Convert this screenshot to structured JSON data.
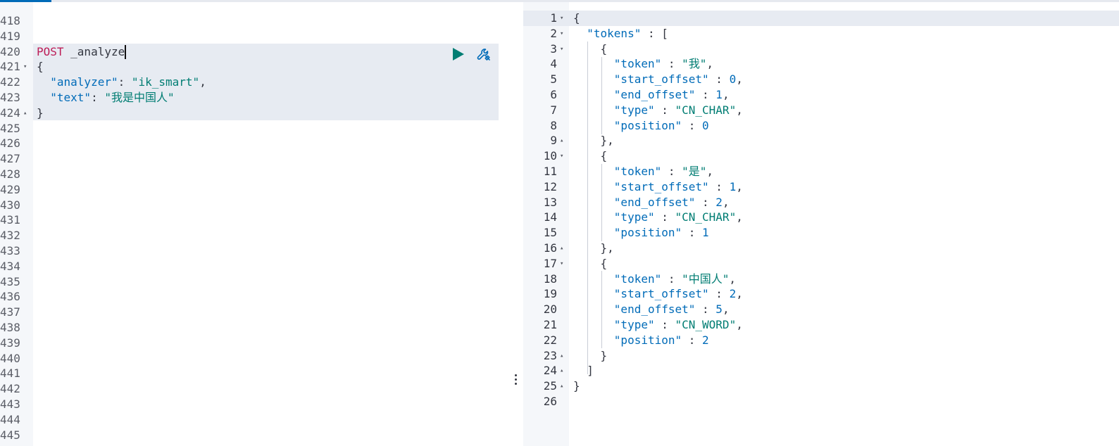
{
  "left_editor": {
    "lines": [
      {
        "num": "418",
        "fold": "",
        "segments": []
      },
      {
        "num": "419",
        "fold": "",
        "segments": []
      },
      {
        "num": "420",
        "fold": "",
        "segments": [
          {
            "text": "POST",
            "cls": "tok-method"
          },
          {
            "text": " _analyze",
            "cls": "tok-path"
          }
        ],
        "cursor": true
      },
      {
        "num": "421",
        "fold": "▾",
        "segments": [
          {
            "text": "{",
            "cls": "tok-punct"
          }
        ]
      },
      {
        "num": "422",
        "fold": "",
        "segments": [
          {
            "text": "  ",
            "cls": "tok-punct"
          },
          {
            "text": "\"analyzer\"",
            "cls": "tok-key"
          },
          {
            "text": ": ",
            "cls": "tok-punct"
          },
          {
            "text": "\"ik_smart\"",
            "cls": "tok-str"
          },
          {
            "text": ",",
            "cls": "tok-punct"
          }
        ]
      },
      {
        "num": "423",
        "fold": "",
        "segments": [
          {
            "text": "  ",
            "cls": "tok-punct"
          },
          {
            "text": "\"text\"",
            "cls": "tok-key"
          },
          {
            "text": ": ",
            "cls": "tok-punct"
          },
          {
            "text": "\"我是中国人\"",
            "cls": "tok-str"
          }
        ]
      },
      {
        "num": "424",
        "fold": "▴",
        "segments": [
          {
            "text": "}",
            "cls": "tok-punct"
          }
        ]
      },
      {
        "num": "425",
        "fold": "",
        "segments": []
      },
      {
        "num": "426",
        "fold": "",
        "segments": []
      },
      {
        "num": "427",
        "fold": "",
        "segments": []
      },
      {
        "num": "428",
        "fold": "",
        "segments": []
      },
      {
        "num": "429",
        "fold": "",
        "segments": []
      },
      {
        "num": "430",
        "fold": "",
        "segments": []
      },
      {
        "num": "431",
        "fold": "",
        "segments": []
      },
      {
        "num": "432",
        "fold": "",
        "segments": []
      },
      {
        "num": "433",
        "fold": "",
        "segments": []
      },
      {
        "num": "434",
        "fold": "",
        "segments": []
      },
      {
        "num": "435",
        "fold": "",
        "segments": []
      },
      {
        "num": "436",
        "fold": "",
        "segments": []
      },
      {
        "num": "437",
        "fold": "",
        "segments": []
      },
      {
        "num": "438",
        "fold": "",
        "segments": []
      },
      {
        "num": "439",
        "fold": "",
        "segments": []
      },
      {
        "num": "440",
        "fold": "",
        "segments": []
      },
      {
        "num": "441",
        "fold": "",
        "segments": []
      },
      {
        "num": "442",
        "fold": "",
        "segments": []
      },
      {
        "num": "443",
        "fold": "",
        "segments": []
      },
      {
        "num": "444",
        "fold": "",
        "segments": []
      },
      {
        "num": "445",
        "fold": "",
        "segments": []
      }
    ],
    "run_icon": "play-icon",
    "settings_icon": "wrench-icon"
  },
  "right_viewer": {
    "lines": [
      {
        "num": "1",
        "fold": "▾",
        "segments": [
          {
            "text": "{",
            "cls": "tok-punct"
          }
        ]
      },
      {
        "num": "2",
        "fold": "▾",
        "segments": [
          {
            "text": "  ",
            "cls": "tok-punct"
          },
          {
            "text": "\"tokens\"",
            "cls": "tok-key"
          },
          {
            "text": " : [",
            "cls": "tok-punct"
          }
        ]
      },
      {
        "num": "3",
        "fold": "▾",
        "segments": [
          {
            "text": "    {",
            "cls": "tok-punct"
          }
        ]
      },
      {
        "num": "4",
        "fold": "",
        "segments": [
          {
            "text": "      ",
            "cls": "tok-punct"
          },
          {
            "text": "\"token\"",
            "cls": "tok-key"
          },
          {
            "text": " : ",
            "cls": "tok-punct"
          },
          {
            "text": "\"我\"",
            "cls": "tok-str"
          },
          {
            "text": ",",
            "cls": "tok-punct"
          }
        ]
      },
      {
        "num": "5",
        "fold": "",
        "segments": [
          {
            "text": "      ",
            "cls": "tok-punct"
          },
          {
            "text": "\"start_offset\"",
            "cls": "tok-key"
          },
          {
            "text": " : ",
            "cls": "tok-punct"
          },
          {
            "text": "0",
            "cls": "tok-key"
          },
          {
            "text": ",",
            "cls": "tok-punct"
          }
        ]
      },
      {
        "num": "6",
        "fold": "",
        "segments": [
          {
            "text": "      ",
            "cls": "tok-punct"
          },
          {
            "text": "\"end_offset\"",
            "cls": "tok-key"
          },
          {
            "text": " : ",
            "cls": "tok-punct"
          },
          {
            "text": "1",
            "cls": "tok-key"
          },
          {
            "text": ",",
            "cls": "tok-punct"
          }
        ]
      },
      {
        "num": "7",
        "fold": "",
        "segments": [
          {
            "text": "      ",
            "cls": "tok-punct"
          },
          {
            "text": "\"type\"",
            "cls": "tok-key"
          },
          {
            "text": " : ",
            "cls": "tok-punct"
          },
          {
            "text": "\"CN_CHAR\"",
            "cls": "tok-str"
          },
          {
            "text": ",",
            "cls": "tok-punct"
          }
        ]
      },
      {
        "num": "8",
        "fold": "",
        "segments": [
          {
            "text": "      ",
            "cls": "tok-punct"
          },
          {
            "text": "\"position\"",
            "cls": "tok-key"
          },
          {
            "text": " : ",
            "cls": "tok-punct"
          },
          {
            "text": "0",
            "cls": "tok-key"
          }
        ]
      },
      {
        "num": "9",
        "fold": "▴",
        "segments": [
          {
            "text": "    },",
            "cls": "tok-punct"
          }
        ]
      },
      {
        "num": "10",
        "fold": "▾",
        "segments": [
          {
            "text": "    {",
            "cls": "tok-punct"
          }
        ]
      },
      {
        "num": "11",
        "fold": "",
        "segments": [
          {
            "text": "      ",
            "cls": "tok-punct"
          },
          {
            "text": "\"token\"",
            "cls": "tok-key"
          },
          {
            "text": " : ",
            "cls": "tok-punct"
          },
          {
            "text": "\"是\"",
            "cls": "tok-str"
          },
          {
            "text": ",",
            "cls": "tok-punct"
          }
        ]
      },
      {
        "num": "12",
        "fold": "",
        "segments": [
          {
            "text": "      ",
            "cls": "tok-punct"
          },
          {
            "text": "\"start_offset\"",
            "cls": "tok-key"
          },
          {
            "text": " : ",
            "cls": "tok-punct"
          },
          {
            "text": "1",
            "cls": "tok-key"
          },
          {
            "text": ",",
            "cls": "tok-punct"
          }
        ]
      },
      {
        "num": "13",
        "fold": "",
        "segments": [
          {
            "text": "      ",
            "cls": "tok-punct"
          },
          {
            "text": "\"end_offset\"",
            "cls": "tok-key"
          },
          {
            "text": " : ",
            "cls": "tok-punct"
          },
          {
            "text": "2",
            "cls": "tok-key"
          },
          {
            "text": ",",
            "cls": "tok-punct"
          }
        ]
      },
      {
        "num": "14",
        "fold": "",
        "segments": [
          {
            "text": "      ",
            "cls": "tok-punct"
          },
          {
            "text": "\"type\"",
            "cls": "tok-key"
          },
          {
            "text": " : ",
            "cls": "tok-punct"
          },
          {
            "text": "\"CN_CHAR\"",
            "cls": "tok-str"
          },
          {
            "text": ",",
            "cls": "tok-punct"
          }
        ]
      },
      {
        "num": "15",
        "fold": "",
        "segments": [
          {
            "text": "      ",
            "cls": "tok-punct"
          },
          {
            "text": "\"position\"",
            "cls": "tok-key"
          },
          {
            "text": " : ",
            "cls": "tok-punct"
          },
          {
            "text": "1",
            "cls": "tok-key"
          }
        ]
      },
      {
        "num": "16",
        "fold": "▴",
        "segments": [
          {
            "text": "    },",
            "cls": "tok-punct"
          }
        ]
      },
      {
        "num": "17",
        "fold": "▾",
        "segments": [
          {
            "text": "    {",
            "cls": "tok-punct"
          }
        ]
      },
      {
        "num": "18",
        "fold": "",
        "segments": [
          {
            "text": "      ",
            "cls": "tok-punct"
          },
          {
            "text": "\"token\"",
            "cls": "tok-key"
          },
          {
            "text": " : ",
            "cls": "tok-punct"
          },
          {
            "text": "\"中国人\"",
            "cls": "tok-str"
          },
          {
            "text": ",",
            "cls": "tok-punct"
          }
        ]
      },
      {
        "num": "19",
        "fold": "",
        "segments": [
          {
            "text": "      ",
            "cls": "tok-punct"
          },
          {
            "text": "\"start_offset\"",
            "cls": "tok-key"
          },
          {
            "text": " : ",
            "cls": "tok-punct"
          },
          {
            "text": "2",
            "cls": "tok-key"
          },
          {
            "text": ",",
            "cls": "tok-punct"
          }
        ]
      },
      {
        "num": "20",
        "fold": "",
        "segments": [
          {
            "text": "      ",
            "cls": "tok-punct"
          },
          {
            "text": "\"end_offset\"",
            "cls": "tok-key"
          },
          {
            "text": " : ",
            "cls": "tok-punct"
          },
          {
            "text": "5",
            "cls": "tok-key"
          },
          {
            "text": ",",
            "cls": "tok-punct"
          }
        ]
      },
      {
        "num": "21",
        "fold": "",
        "segments": [
          {
            "text": "      ",
            "cls": "tok-punct"
          },
          {
            "text": "\"type\"",
            "cls": "tok-key"
          },
          {
            "text": " : ",
            "cls": "tok-punct"
          },
          {
            "text": "\"CN_WORD\"",
            "cls": "tok-str"
          },
          {
            "text": ",",
            "cls": "tok-punct"
          }
        ]
      },
      {
        "num": "22",
        "fold": "",
        "segments": [
          {
            "text": "      ",
            "cls": "tok-punct"
          },
          {
            "text": "\"position\"",
            "cls": "tok-key"
          },
          {
            "text": " : ",
            "cls": "tok-punct"
          },
          {
            "text": "2",
            "cls": "tok-key"
          }
        ]
      },
      {
        "num": "23",
        "fold": "▴",
        "segments": [
          {
            "text": "    }",
            "cls": "tok-punct"
          }
        ]
      },
      {
        "num": "24",
        "fold": "▴",
        "segments": [
          {
            "text": "  ]",
            "cls": "tok-punct"
          }
        ]
      },
      {
        "num": "25",
        "fold": "▴",
        "segments": [
          {
            "text": "}",
            "cls": "tok-punct"
          }
        ]
      },
      {
        "num": "26",
        "fold": "",
        "segments": []
      }
    ]
  },
  "colors": {
    "method": "#bd1d57",
    "key": "#006bb8",
    "string": "#017d73",
    "highlight": "#e7ebf2",
    "run": "#017d73",
    "wrench": "#006bb8"
  },
  "resizer_icon": "vertical-dots-icon"
}
